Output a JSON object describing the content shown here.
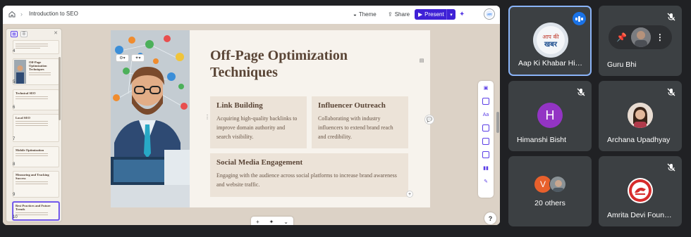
{
  "presentation": {
    "breadcrumb_title": "Introduction to SEO",
    "theme_label": "Theme",
    "share_label": "Share",
    "present_label": "Present",
    "thumbnails": [
      {
        "num": "4",
        "title": ""
      },
      {
        "num": "5",
        "title": "Off-Page Optimization Techniques"
      },
      {
        "num": "6",
        "title": "Technical SEO"
      },
      {
        "num": "7",
        "title": "Local SEO"
      },
      {
        "num": "8",
        "title": "Mobile Optimization"
      },
      {
        "num": "9",
        "title": "Measuring and Tracking Success"
      },
      {
        "num": "10",
        "title": "Best Practices and Future Trends"
      }
    ],
    "slide": {
      "title": "Off-Page Optimization Techniques",
      "cards": [
        {
          "heading": "Link Building",
          "body": "Acquiring high-quality backlinks to improve domain authority and search visibility."
        },
        {
          "heading": "Influencer Outreach",
          "body": "Collaborating with industry influencers to extend brand reach and credibility."
        },
        {
          "heading": "Social Media Engagement",
          "body": "Engaging with the audience across social platforms to increase brand awareness and website traffic."
        }
      ]
    },
    "help_label": "?"
  },
  "participants": [
    {
      "name": "Aap Ki Khabar Hin…",
      "avatar_text": "आप की खबर",
      "speaking": true
    },
    {
      "name": "Guru Bhi",
      "muted": true
    },
    {
      "name": "Himanshi Bisht",
      "avatar_letter": "H",
      "avatar_color": "#9334c4",
      "muted": true
    },
    {
      "name": "Archana Upadhyay",
      "muted": true
    },
    {
      "name": "20 others",
      "avatar_letter": "V",
      "avatar_color": "#e8602c"
    },
    {
      "name": "Amrita Devi Foun…",
      "muted": true
    }
  ],
  "colors": {
    "accent": "#3f21d6",
    "slide_bg": "#f7f3ed",
    "card_bg": "#ece3d8",
    "title": "#5a4536",
    "tile_bg": "#3c4043",
    "active_border": "#8ab4f8"
  }
}
